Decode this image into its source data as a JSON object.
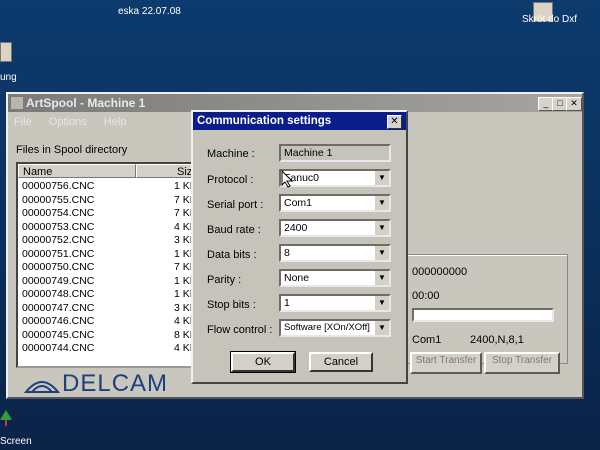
{
  "desktop": {
    "top_label": "eska 22.07.08",
    "shortcut_label": "Skrót do Dxf",
    "left_label": "ung",
    "bottom_left_label": "Screen"
  },
  "window": {
    "title": "ArtSpool - Machine 1",
    "menu": [
      "File",
      "Options",
      "Help"
    ],
    "files_caption": "Files in Spool directory",
    "columns": {
      "name": "Name",
      "size": "Size"
    },
    "files": [
      {
        "name": "00000756.CNC",
        "size": "1 KB"
      },
      {
        "name": "00000755.CNC",
        "size": "7 KB"
      },
      {
        "name": "00000754.CNC",
        "size": "7 KB"
      },
      {
        "name": "00000753.CNC",
        "size": "4 KB"
      },
      {
        "name": "00000752.CNC",
        "size": "3 KB"
      },
      {
        "name": "00000751.CNC",
        "size": "1 KB"
      },
      {
        "name": "00000750.CNC",
        "size": "7 KB"
      },
      {
        "name": "00000749.CNC",
        "size": "1 KB"
      },
      {
        "name": "00000748.CNC",
        "size": "1 KB"
      },
      {
        "name": "00000747.CNC",
        "size": "3 KB"
      },
      {
        "name": "00000746.CNC",
        "size": "4 KB"
      },
      {
        "name": "00000745.CNC",
        "size": "8 KB"
      },
      {
        "name": "00000744.CNC",
        "size": "4 KB"
      }
    ],
    "status": {
      "counter": "000000000",
      "time": "00:00",
      "port": "Com1",
      "settings": "2400,N,8,1"
    },
    "buttons": {
      "start_transfer": "Start Transfer",
      "stop_transfer": "Stop Transfer"
    },
    "logo": "DELCAM"
  },
  "dialog": {
    "title": "Communication settings",
    "close": "✕",
    "fields": [
      {
        "label": "Machine :",
        "value": "Machine 1"
      },
      {
        "label": "Protocol :",
        "value": "Fanuc0"
      },
      {
        "label": "Serial port :",
        "value": "Com1"
      },
      {
        "label": "Baud rate :",
        "value": "2400"
      },
      {
        "label": "Data bits :",
        "value": "8"
      },
      {
        "label": "Parity :",
        "value": "None"
      },
      {
        "label": "Stop bits :",
        "value": "1"
      },
      {
        "label": "Flow control :",
        "value": "Software [XOn/XOff]"
      }
    ],
    "ok": "OK",
    "cancel": "Cancel"
  }
}
